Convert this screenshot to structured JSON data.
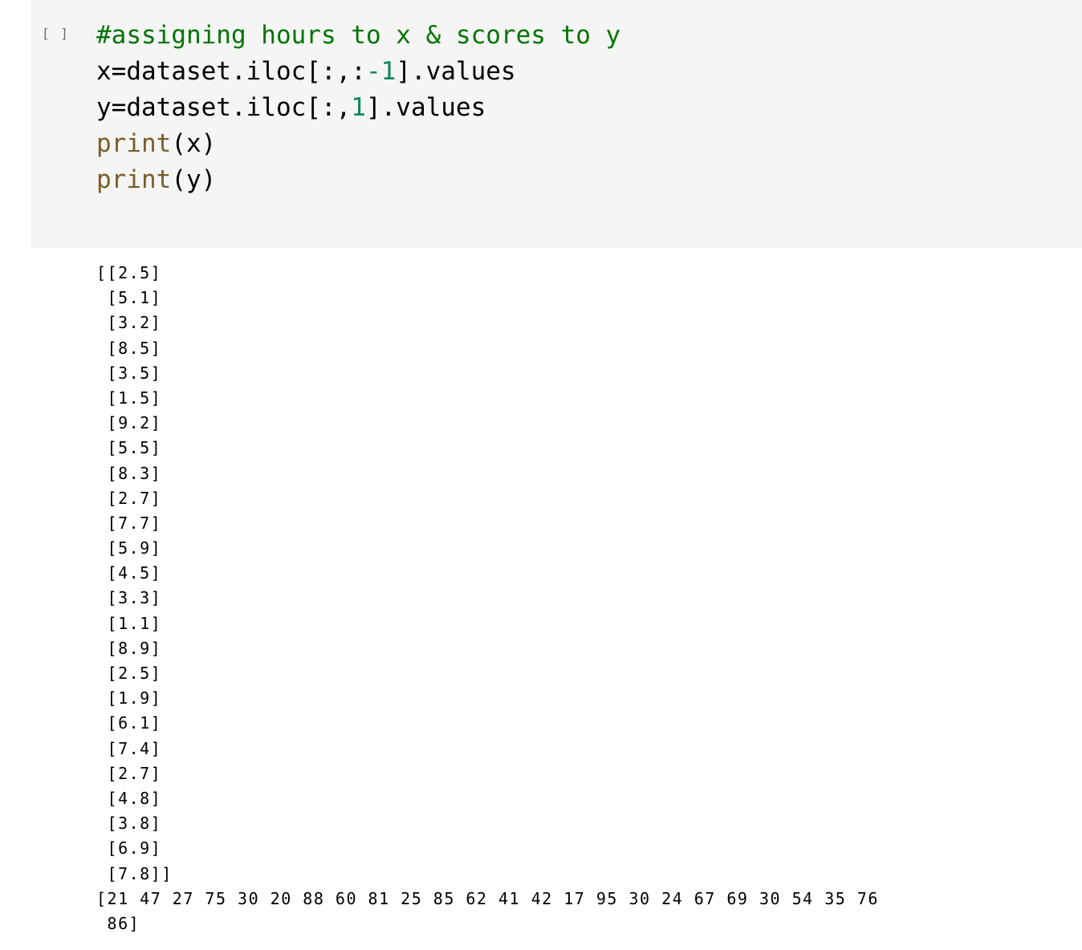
{
  "cell": {
    "run_indicator": "[ ]",
    "code_lines": [
      [
        {
          "t": "#assigning hours to x & scores to y",
          "c": "comment"
        }
      ],
      [
        {
          "t": "x=dataset.iloc[:,:",
          "c": ""
        },
        {
          "t": "-1",
          "c": "number"
        },
        {
          "t": "].values",
          "c": ""
        }
      ],
      [
        {
          "t": "y=dataset.iloc[:,",
          "c": ""
        },
        {
          "t": "1",
          "c": "number"
        },
        {
          "t": "].values",
          "c": ""
        }
      ],
      [
        {
          "t": "print",
          "c": "builtin"
        },
        {
          "t": "(x)",
          "c": ""
        }
      ],
      [
        {
          "t": "print",
          "c": "builtin"
        },
        {
          "t": "(y)",
          "c": ""
        }
      ]
    ]
  },
  "output": {
    "lines": [
      "[[2.5]",
      " [5.1]",
      " [3.2]",
      " [8.5]",
      " [3.5]",
      " [1.5]",
      " [9.2]",
      " [5.5]",
      " [8.3]",
      " [2.7]",
      " [7.7]",
      " [5.9]",
      " [4.5]",
      " [3.3]",
      " [1.1]",
      " [8.9]",
      " [2.5]",
      " [1.9]",
      " [6.1]",
      " [7.4]",
      " [2.7]",
      " [4.8]",
      " [3.8]",
      " [6.9]",
      " [7.8]]",
      "[21 47 27 75 30 20 88 60 81 25 85 62 41 42 17 95 30 24 67 69 30 54 35 76",
      " 86]"
    ]
  },
  "colors": {
    "cell_background": "#f5f5f5",
    "comment": "#007400",
    "number": "#098658",
    "builtin": "#795e26",
    "text": "#000000"
  }
}
